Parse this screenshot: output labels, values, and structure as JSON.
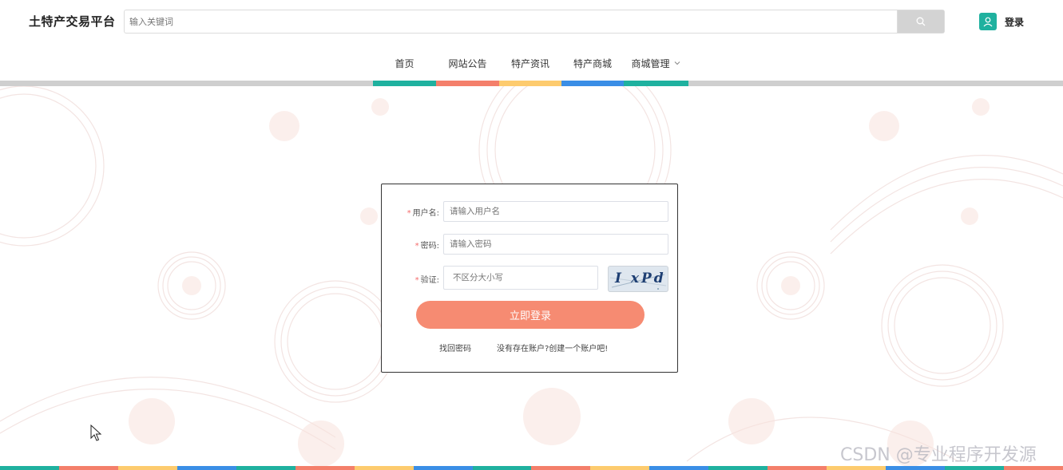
{
  "header": {
    "brand": "土特产交易平台",
    "search_placeholder": "输入关键词",
    "login_label": "登录"
  },
  "nav": {
    "items": [
      {
        "label": "首页",
        "color": "#1fb19f"
      },
      {
        "label": "网站公告",
        "color": "#f47f6b"
      },
      {
        "label": "特产资讯",
        "color": "#fdcb6e"
      },
      {
        "label": "特产商城",
        "color": "#3a8ee6"
      },
      {
        "label": "商城管理",
        "color": "#1fb19f"
      }
    ]
  },
  "login_form": {
    "username_label": "用户名:",
    "username_placeholder": "请输入用户名",
    "password_label": "密码:",
    "password_placeholder": "请输入密码",
    "captcha_label": "验证:",
    "captcha_placeholder": "不区分大小写",
    "captcha_text": "I xPd",
    "required_mark": "*",
    "submit_label": "立即登录",
    "forgot_label": "找回密码",
    "register_label": "没有存在账户?创建一个账户吧!"
  },
  "theme": {
    "accent": "#f68b72",
    "teal": "#1fb19f",
    "required": "#f56c6c"
  },
  "watermark": "CSDN @专业程序开发源"
}
